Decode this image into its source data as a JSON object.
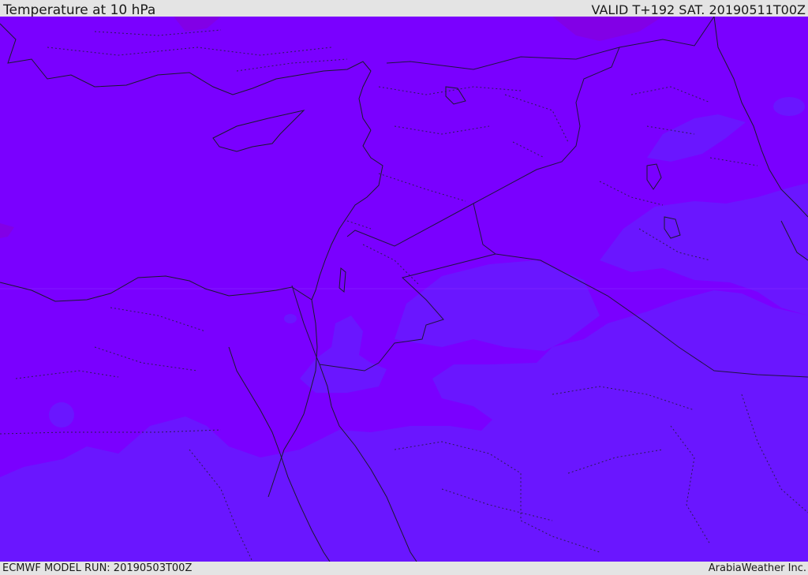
{
  "header": {
    "title": "Temperature at 10 hPa",
    "valid": "VALID T+192 SAT. 20190511T00Z"
  },
  "footer": {
    "model_run": "ECMWF MODEL RUN: 20190503T00Z",
    "brand": "ArabiaWeather Inc."
  },
  "map": {
    "colors": {
      "warm": "#7a00ff",
      "cool": "#6a16ff",
      "warmer_spot": "#8200e6",
      "coastline": "#1a1a2e",
      "border": "#2a1a55"
    }
  }
}
